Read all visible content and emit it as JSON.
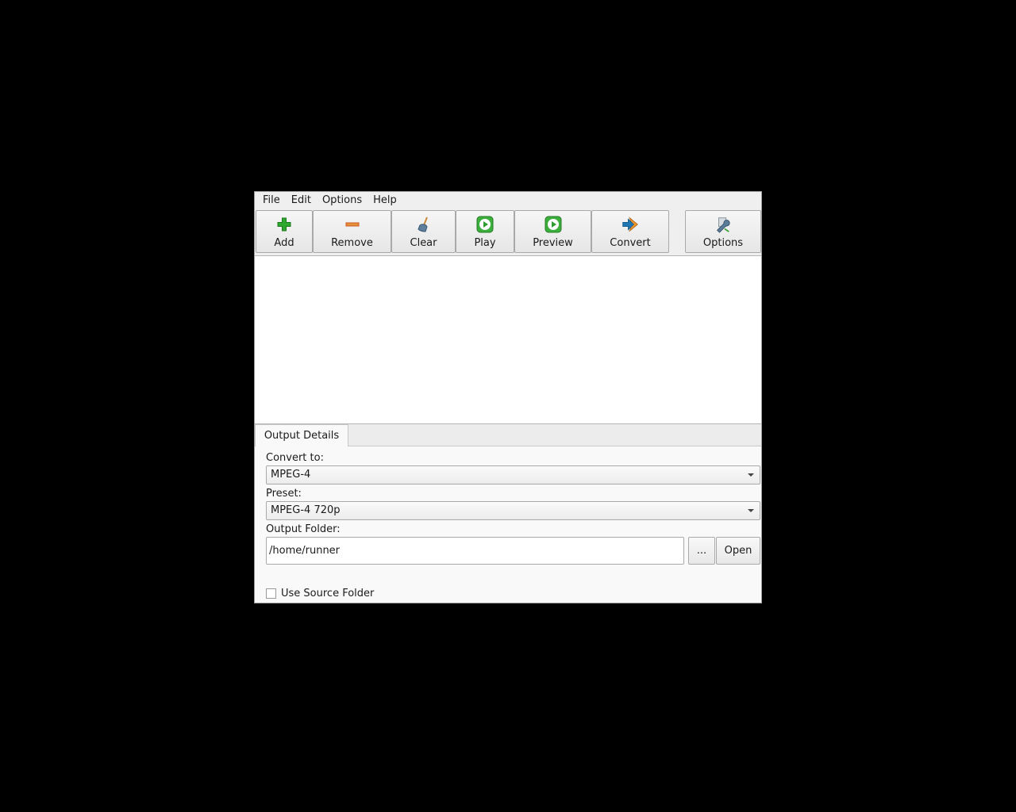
{
  "menu": [
    "File",
    "Edit",
    "Options",
    "Help"
  ],
  "toolbar": {
    "add": "Add",
    "remove": "Remove",
    "clear": "Clear",
    "play": "Play",
    "preview": "Preview",
    "convert": "Convert",
    "options": "Options"
  },
  "tabs": {
    "output_details": "Output Details"
  },
  "output": {
    "convert_to_label": "Convert to:",
    "convert_to_value": "MPEG-4",
    "preset_label": "Preset:",
    "preset_value": "MPEG-4 720p",
    "folder_label": "Output Folder:",
    "folder_value": "/home/runner",
    "browse_label": "...",
    "open_label": "Open",
    "use_source_label": "Use Source Folder",
    "use_source_checked": false
  },
  "icons": {
    "add": "add-plus-icon",
    "remove": "remove-minus-icon",
    "clear": "broom-clear-icon",
    "play": "play-icon",
    "preview": "preview-play-icon",
    "convert": "convert-arrow-icon",
    "options": "wrench-options-icon"
  },
  "colors": {
    "add_green": "#2fa82f",
    "remove_orange": "#e6913a",
    "play_green": "#3cae3c",
    "convert_blue": "#1f78b4",
    "convert_orange": "#e8932e"
  }
}
